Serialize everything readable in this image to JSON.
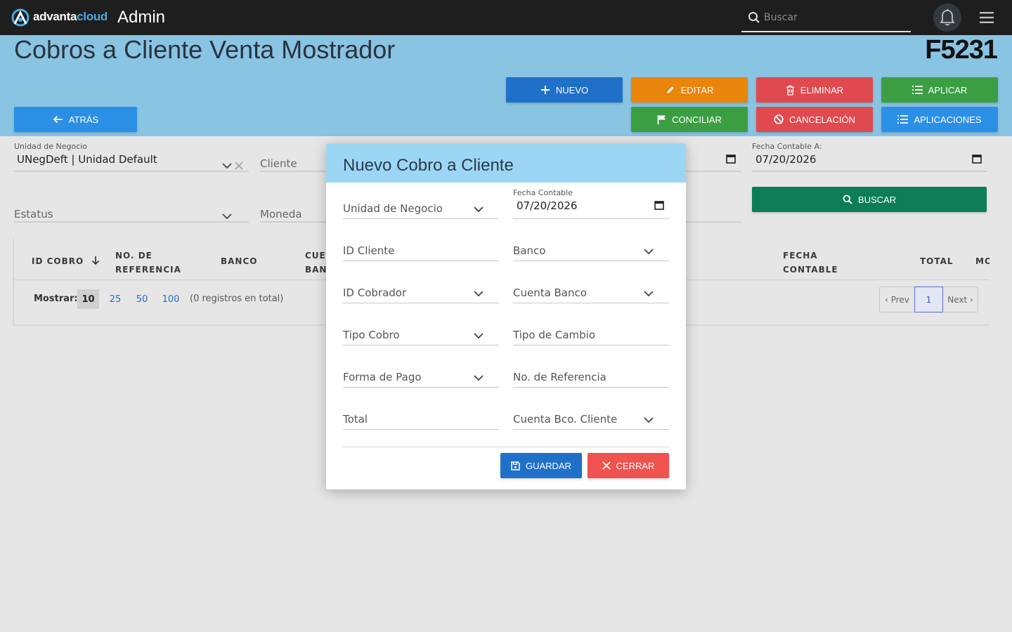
{
  "topbar": {
    "brand_part1": "advanta",
    "brand_part2": "cloud",
    "app_title": "Admin",
    "search_placeholder": "Buscar",
    "icons": [
      "logo-icon",
      "search-icon",
      "bell-icon",
      "hamburger-menu-icon"
    ]
  },
  "header": {
    "page_title": "Cobros a Cliente Venta Mostrador",
    "page_code": "F5231"
  },
  "buttons": {
    "nuevo": "NUEVO",
    "editar": "EDITAR",
    "eliminar": "ELIMINAR",
    "aplicar": "APLICAR",
    "atras": "ATRÁS",
    "conciliar": "CONCILIAR",
    "cancelacion": "CANCELACIÓN",
    "aplicaciones": "APLICACIONES",
    "buscar": "BUSCAR"
  },
  "colors": {
    "topbar": "#1e1e1e",
    "header": "#89c4e2",
    "blue": "#1f70c8",
    "orange": "#e8850a",
    "red": "#e04a4f",
    "green": "#3c9e43",
    "dark_green": "#0c7d57",
    "modal_header": "#9dd6f4"
  },
  "filters": {
    "unidad_negocio_label": "Unidad de Negocio",
    "unidad_negocio_value": "UNegDeft | Unidad Default",
    "cliente_placeholder": "Cliente",
    "estatus_placeholder": "Estatus",
    "moneda_placeholder": "Moneda",
    "fecha_contable_a_label": "Fecha Contable A:",
    "fecha_contable_a_value": "07/20/2026"
  },
  "table": {
    "columns": {
      "id_cobro": "ID COBRO",
      "no_ref_1": "NO. DE",
      "no_ref_2": "REFERENCIA",
      "banco": "BANCO",
      "cuenta_1": "CUEI",
      "cuenta_2": "BAN(",
      "fecha_1": "FECHA",
      "fecha_2": "CONTABLE",
      "total": "TOTAL",
      "moneda": "MO"
    },
    "mostrar_label": "Mostrar:",
    "page_sizes": [
      "10",
      "25",
      "50",
      "100"
    ],
    "selected_page_size": "10",
    "total_text": "(0 registros en total)",
    "pager": {
      "prev": "‹ Prev",
      "current": "1",
      "next": "Next ›"
    }
  },
  "modal": {
    "title": "Nuevo Cobro a Cliente",
    "fields": {
      "unidad_negocio": "Unidad de Negocio",
      "fecha_contable_label": "Fecha Contable",
      "fecha_contable_value": "07/20/2026",
      "id_cliente": "ID Cliente",
      "banco": "Banco",
      "id_cobrador": "ID Cobrador",
      "cuenta_banco": "Cuenta Banco",
      "tipo_cobro": "Tipo Cobro",
      "tipo_cambio": "Tipo de Cambio",
      "forma_pago": "Forma de Pago",
      "no_referencia": "No. de Referencia",
      "total": "Total",
      "cuenta_bco_cliente": "Cuenta Bco. Cliente"
    },
    "guardar": "GUARDAR",
    "cerrar": "CERRAR"
  }
}
